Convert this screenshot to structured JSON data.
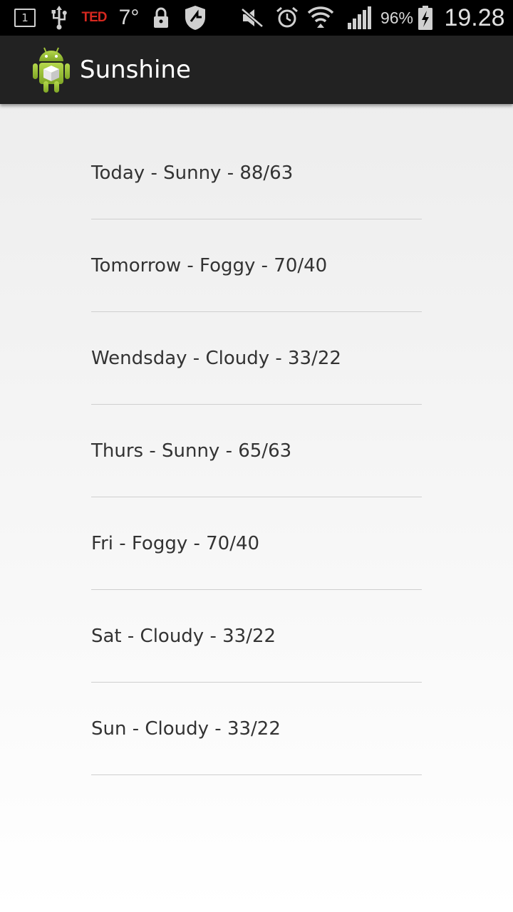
{
  "status_bar": {
    "notification_count": "1",
    "ted_label": "TED",
    "temperature": "7°",
    "battery_percent": "96%",
    "clock": "19.28",
    "icons": [
      "notification-box-icon",
      "usb-icon",
      "ted-icon",
      "lock-icon",
      "shield-icon",
      "mute-icon",
      "alarm-icon",
      "wifi-icon",
      "signal-icon",
      "battery-charging-icon"
    ]
  },
  "action_bar": {
    "title": "Sunshine",
    "icon": "android-app-icon",
    "background_color": "#222222"
  },
  "forecast": {
    "items": [
      {
        "text": "Today - Sunny - 88/63"
      },
      {
        "text": "Tomorrow - Foggy - 70/40"
      },
      {
        "text": "Wendsday - Cloudy - 33/22"
      },
      {
        "text": "Thurs - Sunny - 65/63"
      },
      {
        "text": "Fri - Foggy - 70/40"
      },
      {
        "text": "Sat - Cloudy - 33/22"
      },
      {
        "text": "Sun - Cloudy - 33/22"
      }
    ]
  }
}
